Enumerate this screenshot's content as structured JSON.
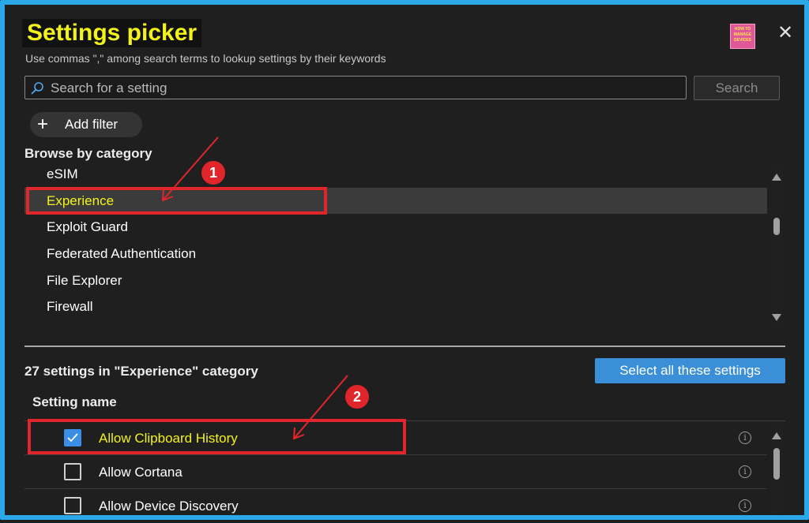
{
  "dialog": {
    "title": "Settings picker",
    "subtitle": "Use commas \",\" among search terms to lookup settings by their keywords",
    "logo_lines": [
      "HOW TO",
      "MANAGE",
      "DEVICES"
    ],
    "close_symbol": "✕"
  },
  "search": {
    "placeholder": "Search for a setting",
    "value": "",
    "button_label": "Search"
  },
  "filter": {
    "add_label": "Add filter"
  },
  "browse": {
    "heading": "Browse by category",
    "categories": [
      {
        "label": "eSIM",
        "selected": false
      },
      {
        "label": "Experience",
        "selected": true
      },
      {
        "label": "Exploit Guard",
        "selected": false
      },
      {
        "label": "Federated Authentication",
        "selected": false
      },
      {
        "label": "File Explorer",
        "selected": false
      },
      {
        "label": "Firewall",
        "selected": false
      }
    ]
  },
  "results": {
    "count_label": "27 settings in \"Experience\" category",
    "select_all_label": "Select all these settings",
    "column_header": "Setting name",
    "settings": [
      {
        "label": "Allow Clipboard History",
        "checked": true
      },
      {
        "label": "Allow Cortana",
        "checked": false
      },
      {
        "label": "Allow Device Discovery",
        "checked": false
      }
    ]
  },
  "annotations": {
    "badge_1": "1",
    "badge_2": "2",
    "color": "#e0262b"
  },
  "colors": {
    "accent_blue": "#3a8fd8",
    "highlight_yellow": "#f3f31a",
    "frame_border": "#2aa8e8"
  }
}
